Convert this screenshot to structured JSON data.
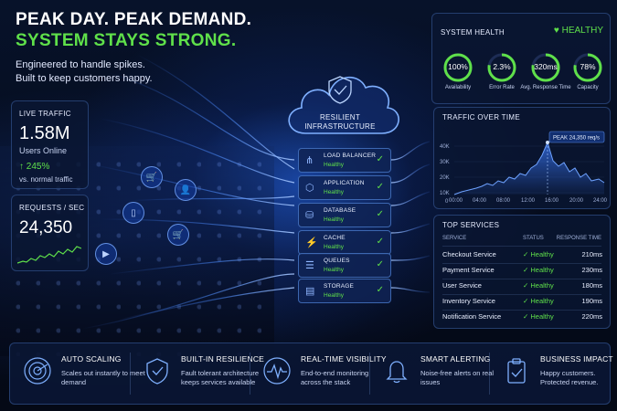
{
  "headline": {
    "line1": "PEAK DAY. PEAK DEMAND.",
    "line2": "SYSTEM STAYS STRONG."
  },
  "subhead": {
    "line1": "Engineered to handle spikes.",
    "line2": "Built to keep customers happy."
  },
  "live_traffic": {
    "label": "LIVE TRAFFIC",
    "value": "1.58M",
    "sub": "Users Online",
    "change": "↑ 245%",
    "change_note": "vs. normal traffic"
  },
  "requests": {
    "label": "REQUESTS / SEC",
    "value": "24,350"
  },
  "cloud": {
    "line1": "RESILIENT",
    "line2": "INFRASTRUCTURE"
  },
  "stack": [
    {
      "name": "LOAD BALANCER",
      "status": "Healthy",
      "icon": "network-icon"
    },
    {
      "name": "APPLICATION",
      "status": "Healthy",
      "icon": "cube-icon"
    },
    {
      "name": "DATABASE",
      "status": "Healthy",
      "icon": "database-icon"
    },
    {
      "name": "CACHE",
      "status": "Healthy",
      "icon": "lightning-icon"
    },
    {
      "name": "QUEUES",
      "status": "Healthy",
      "icon": "queue-icon"
    },
    {
      "name": "STORAGE",
      "status": "Healthy",
      "icon": "storage-icon"
    }
  ],
  "health": {
    "label": "SYSTEM HEALTH",
    "status": "HEALTHY",
    "gauges": [
      {
        "value": "100%",
        "label": "Availability",
        "fill": 1.0
      },
      {
        "value": "2.3%",
        "label": "Error Rate",
        "fill": 0.78
      },
      {
        "value": "320ms",
        "label": "Avg. Response Time",
        "fill": 0.78
      },
      {
        "value": "78%",
        "label": "Capacity",
        "fill": 0.78
      }
    ]
  },
  "traffic": {
    "label": "TRAFFIC OVER TIME",
    "peak": "PEAK 24,350 req/s",
    "yticks": [
      "40K",
      "30K",
      "20K",
      "10K",
      "0"
    ],
    "xticks": [
      "00:00",
      "04:00",
      "08:00",
      "12:00",
      "16:00",
      "20:00",
      "24:00"
    ]
  },
  "services": {
    "label": "TOP SERVICES",
    "headers": {
      "service": "SERVICE",
      "status": "STATUS",
      "response": "RESPONSE TIME"
    },
    "rows": [
      {
        "name": "Checkout Service",
        "status": "Healthy",
        "time": "210ms"
      },
      {
        "name": "Payment Service",
        "status": "Healthy",
        "time": "230ms"
      },
      {
        "name": "User Service",
        "status": "Healthy",
        "time": "180ms"
      },
      {
        "name": "Inventory Service",
        "status": "Healthy",
        "time": "190ms"
      },
      {
        "name": "Notification Service",
        "status": "Healthy",
        "time": "220ms"
      }
    ]
  },
  "features": [
    {
      "title": "AUTO SCALING",
      "desc": "Scales out instantly to meet demand",
      "icon": "radar-icon"
    },
    {
      "title": "BUILT-IN RESILIENCE",
      "desc": "Fault tolerant architecture keeps services available",
      "icon": "shield-icon"
    },
    {
      "title": "REAL-TIME VISIBILITY",
      "desc": "End-to-end monitoring across the stack",
      "icon": "pulse-icon"
    },
    {
      "title": "SMART ALERTING",
      "desc": "Noise-free alerts on real issues",
      "icon": "bell-icon"
    },
    {
      "title": "BUSINESS IMPACT",
      "desc": "Happy customers. Protected revenue.",
      "icon": "clipboard-check-icon"
    }
  ],
  "colors": {
    "accent_green": "#5fe04a",
    "accent_blue": "#3b7bff",
    "background": "#050b1a"
  }
}
